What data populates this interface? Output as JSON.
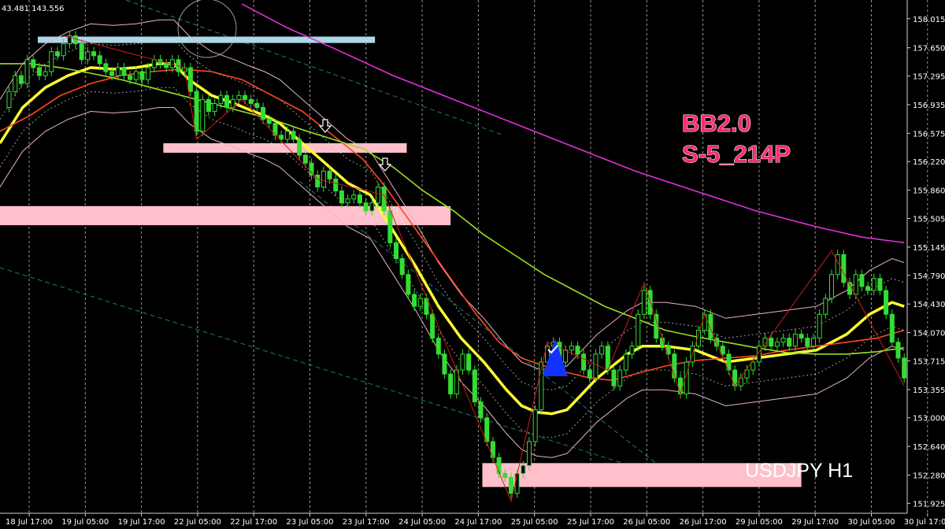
{
  "chart_data": {
    "type": "candlestick",
    "symbol_label": "USDJPY H1",
    "top_info": "43.481 143.556",
    "annotation_lines": [
      "BB2.0",
      "S-5_214P"
    ],
    "ylim": [
      151.8,
      158.25
    ],
    "y_ticks": [
      "158.015",
      "157.650",
      "157.295",
      "156.935",
      "156.575",
      "156.220",
      "155.860",
      "155.505",
      "155.145",
      "154.790",
      "154.430",
      "154.070",
      "153.715",
      "153.355",
      "153.000",
      "152.640",
      "152.280",
      "151.925"
    ],
    "x_ticks": [
      "18 Jul 17:00",
      "19 Jul 05:00",
      "19 Jul 17:00",
      "22 Jul 05:00",
      "22 Jul 17:00",
      "23 Jul 05:00",
      "23 Jul 17:00",
      "24 Jul 05:00",
      "24 Jul 17:00",
      "25 Jul 05:00",
      "25 Jul 17:00",
      "26 Jul 05:00",
      "26 Jul 17:00",
      "29 Jul 05:00",
      "29 Jul 17:00",
      "30 Jul 05:00",
      "30 Jul 17:00"
    ],
    "close_path": [
      [
        0,
        156.9
      ],
      [
        6,
        157.1
      ],
      [
        10,
        157.3
      ],
      [
        14,
        157.2
      ],
      [
        18,
        157.5
      ],
      [
        22,
        157.4
      ],
      [
        26,
        157.3
      ],
      [
        30,
        157.35
      ],
      [
        34,
        157.6
      ],
      [
        38,
        157.55
      ],
      [
        42,
        157.7
      ],
      [
        46,
        157.8
      ],
      [
        50,
        157.7
      ],
      [
        54,
        157.5
      ],
      [
        58,
        157.6
      ],
      [
        62,
        157.55
      ],
      [
        66,
        157.45
      ],
      [
        70,
        157.35
      ],
      [
        74,
        157.3
      ],
      [
        78,
        157.4
      ],
      [
        82,
        157.3
      ],
      [
        86,
        157.25
      ],
      [
        90,
        157.35
      ],
      [
        94,
        157.25
      ],
      [
        98,
        157.4
      ],
      [
        102,
        157.5
      ],
      [
        106,
        157.45
      ],
      [
        110,
        157.4
      ],
      [
        114,
        157.5
      ],
      [
        118,
        157.35
      ],
      [
        122,
        157.4
      ],
      [
        126,
        157.1
      ],
      [
        130,
        156.6
      ],
      [
        134,
        157.0
      ],
      [
        138,
        156.85
      ],
      [
        142,
        156.95
      ],
      [
        146,
        157.05
      ],
      [
        150,
        156.9
      ],
      [
        154,
        157.0
      ],
      [
        158,
        157.05
      ],
      [
        162,
        157.0
      ],
      [
        166,
        156.95
      ],
      [
        170,
        156.9
      ],
      [
        174,
        156.75
      ],
      [
        178,
        156.7
      ],
      [
        182,
        156.55
      ],
      [
        186,
        156.5
      ],
      [
        190,
        156.6
      ],
      [
        194,
        156.5
      ],
      [
        198,
        156.3
      ],
      [
        202,
        156.2
      ],
      [
        206,
        156.05
      ],
      [
        210,
        155.9
      ],
      [
        214,
        156.1
      ],
      [
        218,
        156.0
      ],
      [
        222,
        155.85
      ],
      [
        226,
        155.7
      ],
      [
        230,
        155.75
      ],
      [
        234,
        155.8
      ],
      [
        238,
        155.7
      ],
      [
        242,
        155.6
      ],
      [
        246,
        155.7
      ],
      [
        250,
        155.9
      ],
      [
        254,
        155.6
      ],
      [
        258,
        155.2
      ],
      [
        262,
        155.0
      ],
      [
        266,
        154.8
      ],
      [
        270,
        154.55
      ],
      [
        274,
        154.4
      ],
      [
        278,
        154.5
      ],
      [
        282,
        154.3
      ],
      [
        286,
        154.0
      ],
      [
        290,
        153.8
      ],
      [
        294,
        153.55
      ],
      [
        298,
        153.3
      ],
      [
        302,
        153.6
      ],
      [
        306,
        153.8
      ],
      [
        310,
        153.6
      ],
      [
        314,
        153.2
      ],
      [
        318,
        153.0
      ],
      [
        322,
        152.7
      ],
      [
        326,
        152.5
      ],
      [
        330,
        152.3
      ],
      [
        334,
        152.25
      ],
      [
        338,
        152.05
      ],
      [
        342,
        152.3
      ],
      [
        346,
        152.4
      ],
      [
        350,
        152.7
      ],
      [
        354,
        153.1
      ],
      [
        358,
        153.7
      ],
      [
        362,
        153.9
      ],
      [
        366,
        153.95
      ],
      [
        370,
        153.7
      ],
      [
        374,
        153.85
      ],
      [
        378,
        153.9
      ],
      [
        382,
        153.8
      ],
      [
        386,
        153.6
      ],
      [
        390,
        153.5
      ],
      [
        394,
        153.8
      ],
      [
        398,
        153.9
      ],
      [
        402,
        153.6
      ],
      [
        406,
        153.4
      ],
      [
        410,
        153.6
      ],
      [
        414,
        153.8
      ],
      [
        418,
        153.9
      ],
      [
        422,
        154.3
      ],
      [
        426,
        154.6
      ],
      [
        430,
        154.3
      ],
      [
        434,
        154.0
      ],
      [
        438,
        153.9
      ],
      [
        442,
        153.8
      ],
      [
        446,
        153.5
      ],
      [
        450,
        153.3
      ],
      [
        454,
        153.7
      ],
      [
        458,
        153.9
      ],
      [
        462,
        154.1
      ],
      [
        466,
        154.3
      ],
      [
        470,
        154.0
      ],
      [
        474,
        153.9
      ],
      [
        478,
        153.8
      ],
      [
        482,
        153.6
      ],
      [
        486,
        153.4
      ],
      [
        490,
        153.5
      ],
      [
        494,
        153.6
      ],
      [
        498,
        153.7
      ],
      [
        502,
        153.9
      ],
      [
        506,
        154.0
      ],
      [
        510,
        153.9
      ],
      [
        514,
        153.95
      ],
      [
        518,
        154.0
      ],
      [
        522,
        153.9
      ],
      [
        526,
        154.05
      ],
      [
        530,
        154.0
      ],
      [
        534,
        153.9
      ],
      [
        538,
        154.0
      ],
      [
        542,
        154.3
      ],
      [
        546,
        154.5
      ],
      [
        550,
        154.8
      ],
      [
        554,
        155.05
      ],
      [
        558,
        154.7
      ],
      [
        562,
        154.55
      ],
      [
        566,
        154.8
      ],
      [
        570,
        154.65
      ],
      [
        574,
        154.6
      ],
      [
        578,
        154.75
      ],
      [
        582,
        154.6
      ],
      [
        586,
        154.3
      ],
      [
        590,
        153.95
      ],
      [
        594,
        153.75
      ],
      [
        598,
        153.5
      ]
    ],
    "series": [
      {
        "name": "",
        "color": "#ffff33",
        "values": [
          [
            0,
            156.45
          ],
          [
            15,
            156.9
          ],
          [
            30,
            157.15
          ],
          [
            45,
            157.3
          ],
          [
            60,
            157.4
          ],
          [
            75,
            157.38
          ],
          [
            90,
            157.4
          ],
          [
            105,
            157.45
          ],
          [
            115,
            157.45
          ],
          [
            125,
            157.25
          ],
          [
            140,
            157.05
          ],
          [
            155,
            156.95
          ],
          [
            165,
            156.87
          ],
          [
            175,
            156.8
          ],
          [
            185,
            156.7
          ],
          [
            200,
            156.45
          ],
          [
            215,
            156.2
          ],
          [
            230,
            155.95
          ],
          [
            245,
            155.8
          ],
          [
            260,
            155.35
          ],
          [
            275,
            154.9
          ],
          [
            290,
            154.4
          ],
          [
            305,
            154.0
          ],
          [
            320,
            153.7
          ],
          [
            335,
            153.35
          ],
          [
            345,
            153.15
          ],
          [
            355,
            153.07
          ],
          [
            365,
            153.05
          ],
          [
            375,
            153.1
          ],
          [
            385,
            153.3
          ],
          [
            395,
            153.5
          ],
          [
            405,
            153.65
          ],
          [
            415,
            153.8
          ],
          [
            425,
            153.9
          ],
          [
            440,
            153.9
          ],
          [
            460,
            153.85
          ],
          [
            480,
            153.7
          ],
          [
            500,
            153.75
          ],
          [
            520,
            153.8
          ],
          [
            540,
            153.85
          ],
          [
            560,
            154.05
          ],
          [
            575,
            154.3
          ],
          [
            590,
            154.45
          ],
          [
            598,
            154.4
          ]
        ]
      },
      {
        "name": "",
        "color": "#ff4820",
        "values": [
          [
            0,
            156.6
          ],
          [
            20,
            156.8
          ],
          [
            40,
            157.05
          ],
          [
            60,
            157.2
          ],
          [
            80,
            157.3
          ],
          [
            100,
            157.35
          ],
          [
            120,
            157.38
          ],
          [
            140,
            157.35
          ],
          [
            160,
            157.25
          ],
          [
            180,
            157.05
          ],
          [
            200,
            156.85
          ],
          [
            220,
            156.55
          ],
          [
            240,
            156.25
          ],
          [
            255,
            155.9
          ],
          [
            270,
            155.5
          ],
          [
            285,
            155.1
          ],
          [
            300,
            154.7
          ],
          [
            315,
            154.3
          ],
          [
            330,
            153.95
          ],
          [
            345,
            153.75
          ],
          [
            360,
            153.65
          ],
          [
            375,
            153.57
          ],
          [
            390,
            153.5
          ],
          [
            405,
            153.47
          ],
          [
            420,
            153.55
          ],
          [
            440,
            153.65
          ],
          [
            460,
            153.72
          ],
          [
            480,
            153.75
          ],
          [
            500,
            153.78
          ],
          [
            520,
            153.85
          ],
          [
            540,
            153.9
          ],
          [
            560,
            153.95
          ],
          [
            580,
            154.0
          ],
          [
            598,
            154.1
          ]
        ]
      },
      {
        "name": "",
        "color": "#99e022",
        "values": [
          [
            0,
            157.45
          ],
          [
            20,
            157.45
          ],
          [
            40,
            157.4
          ],
          [
            60,
            157.33
          ],
          [
            80,
            157.25
          ],
          [
            100,
            157.15
          ],
          [
            120,
            157.05
          ],
          [
            140,
            156.95
          ],
          [
            160,
            156.85
          ],
          [
            180,
            156.75
          ],
          [
            200,
            156.62
          ],
          [
            220,
            156.5
          ],
          [
            240,
            156.38
          ],
          [
            260,
            156.15
          ],
          [
            280,
            155.85
          ],
          [
            300,
            155.6
          ],
          [
            320,
            155.3
          ],
          [
            340,
            155.05
          ],
          [
            360,
            154.8
          ],
          [
            380,
            154.6
          ],
          [
            400,
            154.4
          ],
          [
            420,
            154.25
          ],
          [
            440,
            154.1
          ],
          [
            460,
            154.02
          ],
          [
            480,
            153.95
          ],
          [
            500,
            153.88
          ],
          [
            520,
            153.82
          ],
          [
            540,
            153.8
          ],
          [
            560,
            153.8
          ],
          [
            580,
            153.83
          ],
          [
            598,
            153.88
          ]
        ]
      },
      {
        "name": "",
        "color": "#e52fd6",
        "values": [
          [
            160,
            158.2
          ],
          [
            190,
            157.9
          ],
          [
            220,
            157.65
          ],
          [
            260,
            157.3
          ],
          [
            300,
            157.0
          ],
          [
            340,
            156.7
          ],
          [
            380,
            156.4
          ],
          [
            420,
            156.1
          ],
          [
            460,
            155.85
          ],
          [
            500,
            155.6
          ],
          [
            540,
            155.4
          ],
          [
            570,
            155.27
          ],
          [
            598,
            155.2
          ]
        ]
      }
    ],
    "horizontal_zones": [
      {
        "x0": 25,
        "x1": 248,
        "y0": 157.79,
        "y1": 157.71,
        "color": "#add8e6"
      },
      {
        "x0": 108,
        "x1": 269,
        "y0": 156.45,
        "y1": 156.33,
        "color": "#ffc0cb"
      },
      {
        "x0": 0,
        "x1": 298,
        "y0": 155.66,
        "y1": 155.42,
        "color": "#ffc0cb"
      },
      {
        "x0": 319,
        "x1": 530,
        "y0": 152.43,
        "y1": 152.13,
        "color": "#ffc0cb"
      }
    ],
    "grid": true
  }
}
